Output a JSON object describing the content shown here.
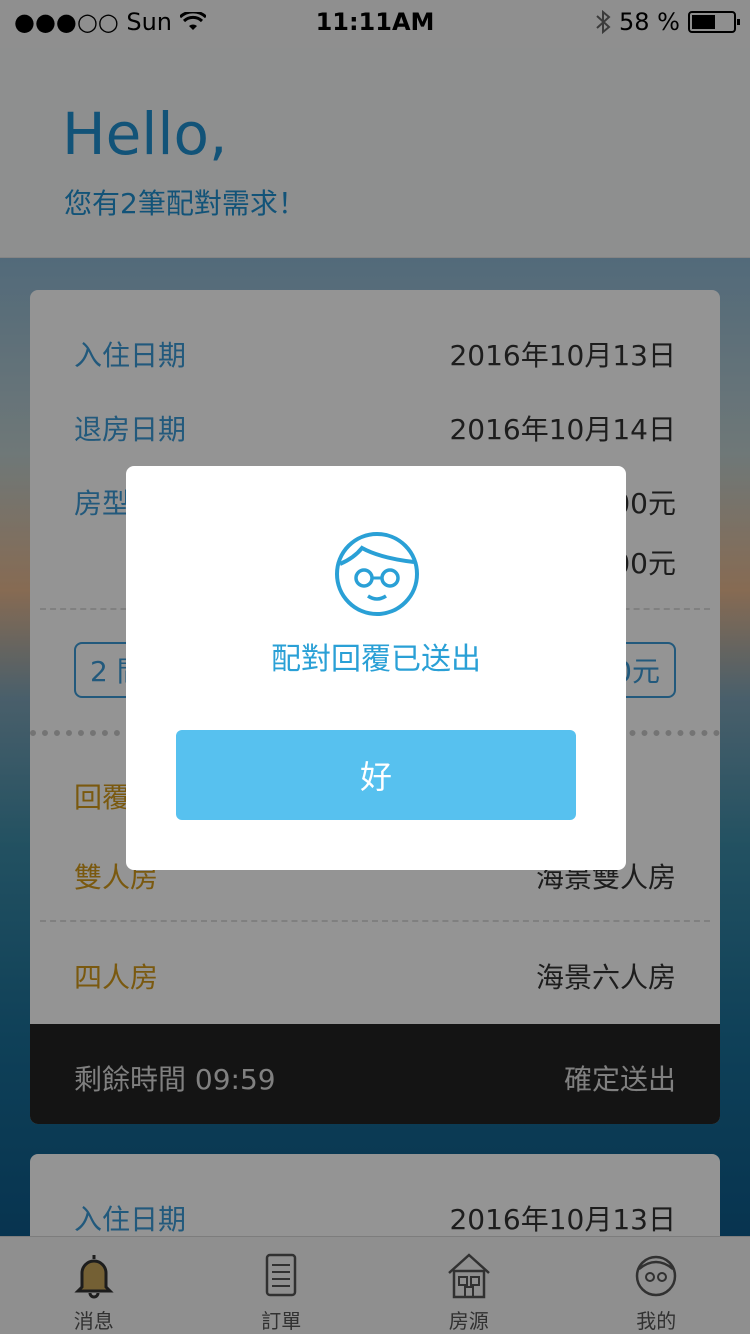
{
  "status_bar": {
    "carrier": "●●●○○ Sun",
    "time": "11:11AM",
    "battery_text": "58 %",
    "battery_level": 0.58
  },
  "header": {
    "greeting": "Hello,",
    "subtitle": "您有2筆配對需求！"
  },
  "card": {
    "rows": [
      {
        "label": "入住日期",
        "value": "2016年10月13日"
      },
      {
        "label": "退房日期",
        "value": "2016年10月14日"
      },
      {
        "label": "房型",
        "value": "00元"
      },
      {
        "label": "",
        "value": "00元"
      }
    ],
    "pill_left": "2 間",
    "pill_right": "0元",
    "reply_label": "回覆",
    "reply_rows": [
      {
        "label": "雙人房",
        "value": "海景雙人房"
      },
      {
        "label": "四人房",
        "value": "海景六人房"
      }
    ],
    "footer_left": "剩餘時間 09:59",
    "footer_right": "確定送出"
  },
  "card2": {
    "label": "入住日期",
    "value": "2016年10月13日"
  },
  "dialog": {
    "message": "配對回覆已送出",
    "ok_label": "好"
  },
  "tabbar": {
    "items": [
      {
        "label": "消息",
        "icon": "bell-icon"
      },
      {
        "label": "訂單",
        "icon": "document-icon"
      },
      {
        "label": "房源",
        "icon": "house-icon"
      },
      {
        "label": "我的",
        "icon": "profile-icon"
      }
    ]
  },
  "colors": {
    "accent": "#3b9ad6",
    "button": "#57c1ef",
    "gold": "#d39a1a"
  }
}
